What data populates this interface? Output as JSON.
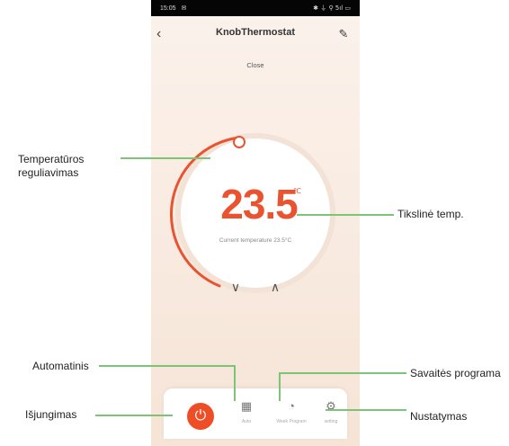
{
  "status_bar": {
    "time": "15:05",
    "icons": "✱ ⏚ ⚲ 5ıl ▭"
  },
  "header": {
    "title": "KnobThermostat",
    "subtitle": "Close",
    "back_icon": "‹",
    "edit_icon": "✎"
  },
  "dial": {
    "target_temp": "23.5",
    "unit": "℃",
    "current_temp_label": "Current temperature 23.5°C",
    "arc_color": "#e9532f",
    "down_arrow": "∨",
    "up_arrow": "∧"
  },
  "bottom_bar": {
    "power_icon": "⏻",
    "items": [
      {
        "label": "Auto",
        "icon": "▦"
      },
      {
        "label": "Week Program",
        "icon": "◔"
      },
      {
        "label": "setting",
        "icon": "⚙"
      }
    ]
  },
  "annotations": {
    "temp_adjust": "Temperatūros reguliavimas",
    "target_temp": "Tikslinė temp.",
    "automatic": "Automatinis",
    "week_program": "Savaitės programa",
    "power_off": "Išjungimas",
    "settings": "Nustatymas"
  }
}
